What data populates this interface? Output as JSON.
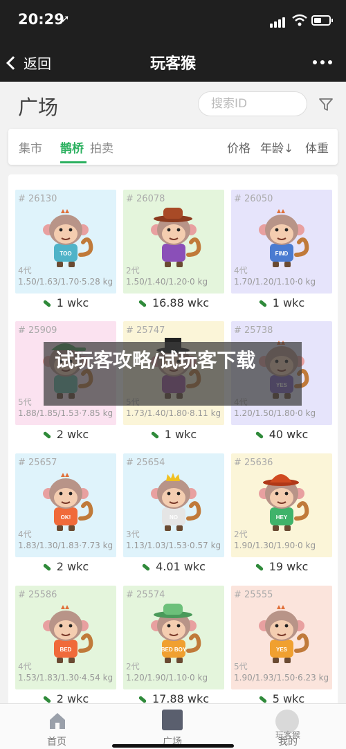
{
  "status_bar": {
    "time": "20:29",
    "location_glyph": "➚"
  },
  "nav": {
    "back_label": "返回",
    "title": "玩客猴"
  },
  "page": {
    "heading": "广场",
    "search_placeholder": "搜索ID"
  },
  "tabs": {
    "items": [
      "集市",
      "鹊桥",
      "拍卖"
    ],
    "active": "鹊桥"
  },
  "sort": {
    "price": "价格",
    "age": "年龄↓",
    "weight": "体重"
  },
  "currency": "wkc",
  "colors": {
    "accent": "#2bb05f",
    "nav_bg": "#1f1f1f"
  },
  "cards": [
    {
      "id": "# 26130",
      "gen": "4代",
      "stats": "1.50/1.63/1.70·5.28 kg",
      "price": "1 wkc",
      "bg": "#dff3fb",
      "shirt": "#4fb3c8",
      "hat": "none",
      "shirt_text": "TOO"
    },
    {
      "id": "# 26078",
      "gen": "2代",
      "stats": "1.50/1.40/1.20·0 kg",
      "price": "16.88 wkc",
      "bg": "#e4f5dc",
      "shirt": "#8a4fb8",
      "hat": "fedora-brown",
      "shirt_text": ""
    },
    {
      "id": "# 26050",
      "gen": "4代",
      "stats": "1.70/1.20/1.10·0 kg",
      "price": "1 wkc",
      "bg": "#e6e4fb",
      "shirt": "#4a7bd1",
      "hat": "none",
      "shirt_text": "FIND"
    },
    {
      "id": "# 25909",
      "gen": "5代",
      "stats": "1.88/1.85/1.53·7.85 kg",
      "price": "2 wkc",
      "bg": "#fbe2f0",
      "shirt": "#5fb3a0",
      "hat": "cap-green",
      "shirt_text": ""
    },
    {
      "id": "# 25747",
      "gen": "5代",
      "stats": "1.73/1.40/1.80·8.11 kg",
      "price": "1 wkc",
      "bg": "#fbf5d8",
      "shirt": "#9a4f9a",
      "hat": "tophat",
      "shirt_text": ""
    },
    {
      "id": "# 25738",
      "gen": "4代",
      "stats": "1.20/1.50/1.80·0 kg",
      "price": "40 wkc",
      "bg": "#e6e4fb",
      "shirt": "#7a5fc0",
      "hat": "none",
      "shirt_text": "YES"
    },
    {
      "id": "# 25657",
      "gen": "4代",
      "stats": "1.83/1.30/1.83·7.73 kg",
      "price": "2 wkc",
      "bg": "#dff3fb",
      "shirt": "#f06a3a",
      "hat": "none",
      "shirt_text": "OK!"
    },
    {
      "id": "# 25654",
      "gen": "3代",
      "stats": "1.13/1.03/1.53·0.57 kg",
      "price": "4.01 wkc",
      "bg": "#dff3fb",
      "shirt": "#e5e5e5",
      "hat": "crown",
      "shirt_text": "NO"
    },
    {
      "id": "# 25636",
      "gen": "2代",
      "stats": "1.90/1.30/1.90·0 kg",
      "price": "19 wkc",
      "bg": "#fbf5d8",
      "shirt": "#3fb36a",
      "hat": "bowler-red",
      "shirt_text": "HEY"
    },
    {
      "id": "# 25586",
      "gen": "4代",
      "stats": "1.53/1.83/1.30·4.54 kg",
      "price": "2 wkc",
      "bg": "#e4f5dc",
      "shirt": "#f06a3a",
      "hat": "none",
      "shirt_text": "BED"
    },
    {
      "id": "# 25574",
      "gen": "2代",
      "stats": "1.20/1.90/1.10·0 kg",
      "price": "17.88 wkc",
      "bg": "#e4f5dc",
      "shirt": "#f0a030",
      "hat": "fedora-green",
      "shirt_text": "BED BOY"
    },
    {
      "id": "# 25555",
      "gen": "5代",
      "stats": "1.90/1.93/1.50·6.23 kg",
      "price": "5 wkc",
      "bg": "#fbe4dc",
      "shirt": "#f0a030",
      "hat": "none",
      "shirt_text": "YES"
    }
  ],
  "overlay_banner": "试玩客攻略/试玩客下载",
  "tabbar": {
    "items": [
      "首页",
      "广场",
      "我的"
    ],
    "watermark": "玩客猴"
  }
}
